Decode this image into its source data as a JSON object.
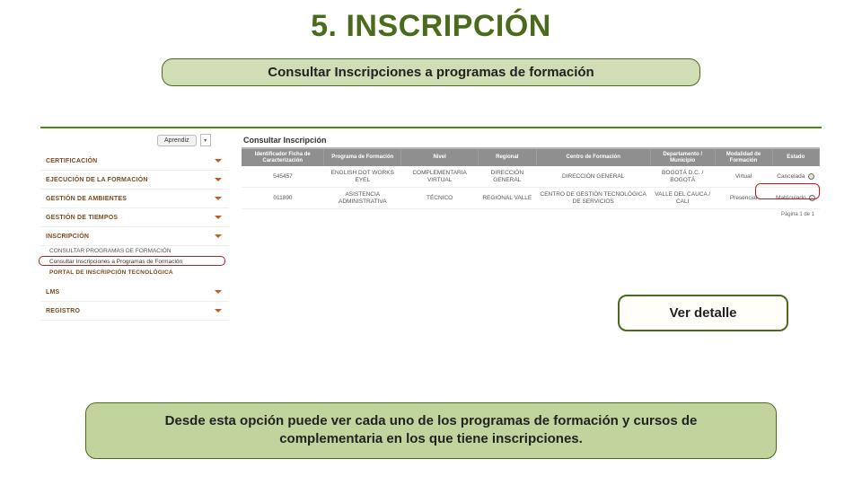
{
  "title": "5. INSCRIPCIÓN",
  "subtitle": "Consultar Inscripciones a programas de formación",
  "role_button": "Aprendiz",
  "panel_title": "Consultar Inscripción",
  "sidebar": {
    "items": [
      {
        "label": "CERTIFICACIÓN"
      },
      {
        "label": "EJECUCIÓN DE LA FORMACIÓN"
      },
      {
        "label": "GESTIÓN DE AMBIENTES"
      },
      {
        "label": "GESTIÓN DE TIEMPOS"
      },
      {
        "label": "INSCRIPCIÓN"
      },
      {
        "label": "LMS"
      },
      {
        "label": "REGISTRO"
      }
    ],
    "sub1": "CONSULTAR PROGRAMAS DE FORMACIÓN",
    "sub2": "Consultar Inscripciones a Programas de Formación",
    "sub3": "PORTAL DE INSCRIPCIÓN TECNOLÓGICA"
  },
  "table": {
    "headers": [
      "Identificador Ficha de Caracterización",
      "Programa de Formación",
      "Nivel",
      "Regional",
      "Centro de Formación",
      "Departamento / Municipio",
      "Modalidad de Formación",
      "Estado"
    ],
    "rows": [
      {
        "id": "545457",
        "programa": "ENGLISH DOT WORKS EYEL",
        "nivel": "COMPLEMENTARIA VIRTUAL",
        "regional": "DIRECCIÓN GENERAL",
        "centro": "DIRECCIÓN GENERAL",
        "depto": "BOGOTÁ D.C. / BOGOTÁ",
        "modalidad": "Virtual",
        "estado": "Cancelada"
      },
      {
        "id": "011890",
        "programa": "ASISTENCIA ADMINISTRATIVA",
        "nivel": "TÉCNICO",
        "regional": "REGIONAL VALLE",
        "centro": "CENTRO DE GESTIÓN TECNOLÓGICA DE SERVICIOS",
        "depto": "VALLE DEL CAUCA / CALI",
        "modalidad": "Presencial",
        "estado": "Matriculado"
      }
    ],
    "pager": "Página 1 de 1"
  },
  "ver_detalle": "Ver detalle",
  "footer": "Desde esta opción puede ver cada uno de los programas de formación y cursos de complementaria en los que tiene inscripciones."
}
